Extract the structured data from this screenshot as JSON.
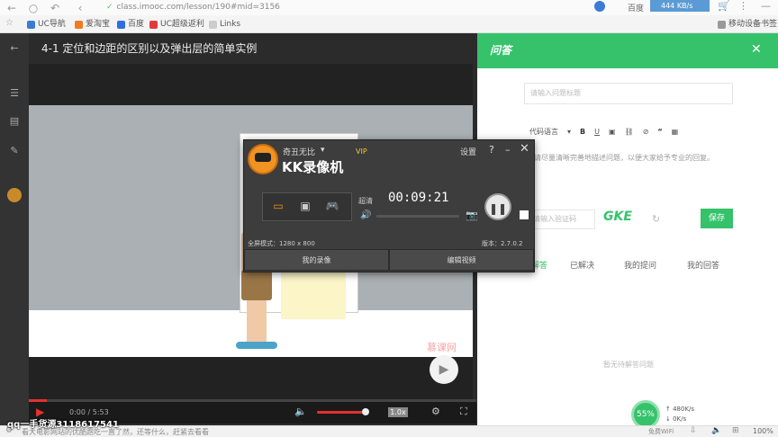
{
  "browser": {
    "url": "class.imooc.com/lesson/190#mid=3156",
    "account_label": "百度",
    "speed_badge": "444 KB/s",
    "mobile_bookmarks": "移动设备书签",
    "bookmarks": [
      {
        "label": "UC导航",
        "color": "#3a7bd5"
      },
      {
        "label": "爱淘宝",
        "color": "#f27a1e"
      },
      {
        "label": "百度",
        "color": "#2f6ee0"
      },
      {
        "label": "UC超级返利",
        "color": "#e4393c"
      },
      {
        "label": "Links",
        "color": "#aaaaaa"
      }
    ]
  },
  "lesson": {
    "title": "4-1 定位和边距的区别以及弹出层的简单实例"
  },
  "video": {
    "watermark": "慕课网",
    "time": "0:00 / 5:53",
    "speed": "1.0x",
    "progress": 0.0,
    "volume": 0.88
  },
  "qa": {
    "header": "问答",
    "title_placeholder": "请输入问题标题",
    "editor_code_lang": "代码语言",
    "editor_hint": "请尽量清晰完善地描述问题，以便大家给予专业的回复。",
    "captcha_placeholder": "请输入验证码",
    "captcha_text": "GKE",
    "save_label": "保存",
    "tabs": [
      "待解答",
      "已解决",
      "我的提问",
      "我的回答"
    ],
    "empty_text": "暂无待解答问题"
  },
  "recorder": {
    "brand": "奇丑无比",
    "title": "KK录像机",
    "vip": "VIP",
    "settings": "设置",
    "quality": "超清",
    "timer": "00:09:21",
    "fullscreen_mode": "全屏模式：1280 x 800",
    "version": "版本：2.7.0.2",
    "my_recordings": "我的录像",
    "edit_video": "编辑视频"
  },
  "netspeed": {
    "percent": "55%",
    "up": "480K/s",
    "down": "0K/s",
    "wifi": "免费WiFi"
  },
  "status": {
    "overlay": "qq一手货源3118617541",
    "message": "看大电影网站的优酷跑吃一直了然，还等什么，赶紧去看看",
    "zoom": "100%"
  }
}
